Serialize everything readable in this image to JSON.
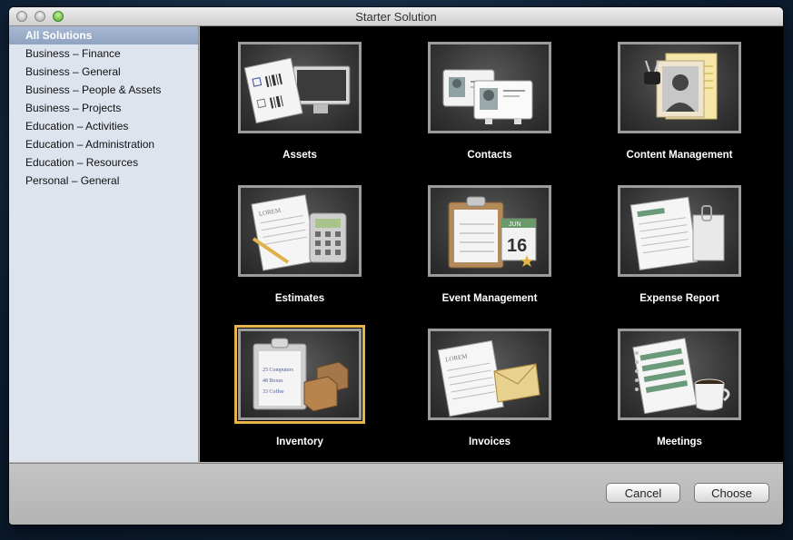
{
  "window": {
    "title": "Starter Solution"
  },
  "sidebar": {
    "items": [
      {
        "label": "All Solutions",
        "selected": true
      },
      {
        "label": "Business – Finance"
      },
      {
        "label": "Business – General"
      },
      {
        "label": "Business – People & Assets"
      },
      {
        "label": "Business – Projects"
      },
      {
        "label": "Education – Activities"
      },
      {
        "label": "Education – Administration"
      },
      {
        "label": "Education – Resources"
      },
      {
        "label": "Personal – General"
      }
    ]
  },
  "solutions": [
    {
      "label": "Assets",
      "icon": "assets-icon"
    },
    {
      "label": "Contacts",
      "icon": "contacts-icon"
    },
    {
      "label": "Content Management",
      "icon": "content-management-icon"
    },
    {
      "label": "Estimates",
      "icon": "estimates-icon"
    },
    {
      "label": "Event Management",
      "icon": "event-management-icon"
    },
    {
      "label": "Expense Report",
      "icon": "expense-report-icon"
    },
    {
      "label": "Inventory",
      "icon": "inventory-icon",
      "selected": true
    },
    {
      "label": "Invoices",
      "icon": "invoices-icon"
    },
    {
      "label": "Meetings",
      "icon": "meetings-icon"
    }
  ],
  "calendar_date": "16",
  "calendar_month": "JUN",
  "inventory_lines": [
    "25 Computers",
    "48 Boxes",
    "33 Coffee"
  ],
  "footer": {
    "cancel_label": "Cancel",
    "choose_label": "Choose"
  },
  "colors": {
    "selection_highlight": "#e8b34a",
    "sidebar_bg": "#dde4ed",
    "grid_bg": "#000000"
  }
}
